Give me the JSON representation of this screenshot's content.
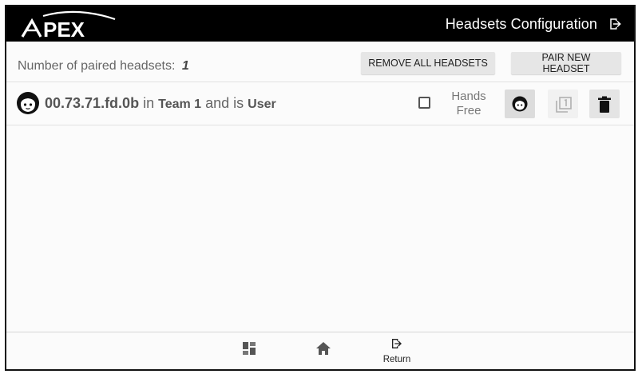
{
  "app": {
    "logo_text": "APEX",
    "title": "Headsets Configuration"
  },
  "summary": {
    "label": "Number of paired headsets:",
    "count": "1"
  },
  "actions": {
    "remove_all": "REMOVE ALL HEADSETS",
    "pair_new": "PAIR NEW HEADSET"
  },
  "headsets": [
    {
      "id": "00.73.71.fd.0b",
      "in_text": "in",
      "team": "Team 1",
      "and_text": "and is",
      "role": "User",
      "hands_free_label_1": "Hands",
      "hands_free_label_2": "Free",
      "hands_free_checked": false,
      "slot_icon": "filter-1-icon"
    }
  ],
  "bottom_nav": {
    "return_label": "Return"
  },
  "colors": {
    "topbar": "#000000",
    "button_bg": "#e6e6e6",
    "text_muted": "#666666"
  }
}
